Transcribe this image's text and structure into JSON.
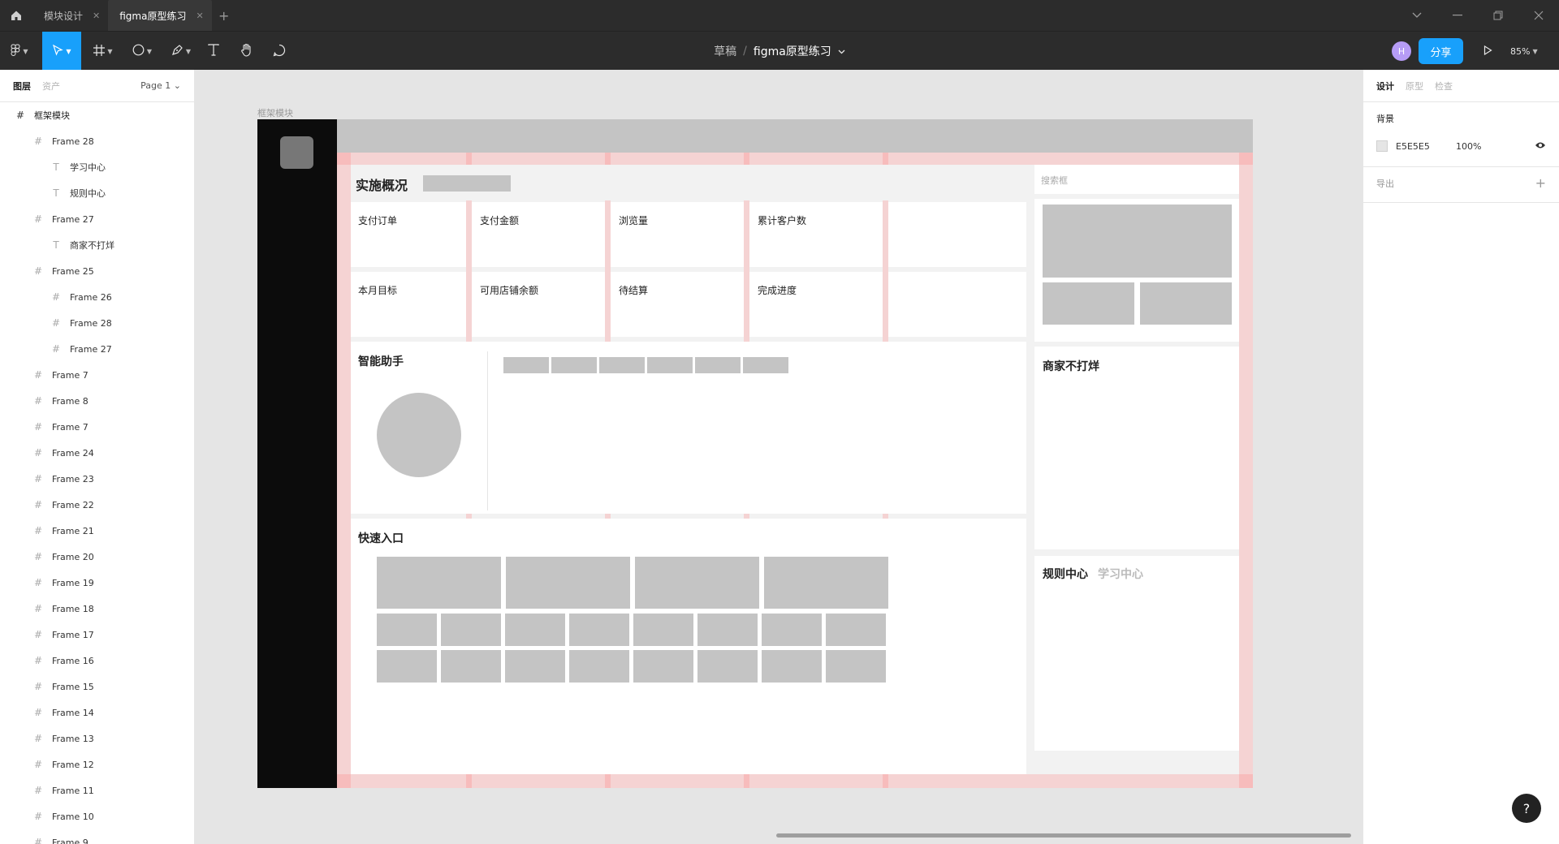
{
  "titlebar": {
    "tabs": [
      {
        "label": "模块设计",
        "active": false
      },
      {
        "label": "figma原型练习",
        "active": true
      }
    ],
    "new_tab": "+"
  },
  "toolbar": {
    "breadcrumb": "草稿",
    "separator": "/",
    "doc_name": "figma原型练习",
    "avatar": "H",
    "share": "分享",
    "zoom": "85%",
    "active_tool": "move"
  },
  "left_panel": {
    "tabs": [
      "图层",
      "资产"
    ],
    "page": "Page 1",
    "layers": [
      {
        "label": "框架模块",
        "icon": "frame",
        "indent": 0
      },
      {
        "label": "Frame 28",
        "icon": "frame",
        "indent": 1
      },
      {
        "label": "学习中心",
        "icon": "text",
        "indent": 2
      },
      {
        "label": "规则中心",
        "icon": "text",
        "indent": 2
      },
      {
        "label": "Frame 27",
        "icon": "frame",
        "indent": 1
      },
      {
        "label": "商家不打烊",
        "icon": "text",
        "indent": 2
      },
      {
        "label": "Frame 25",
        "icon": "frame",
        "indent": 1
      },
      {
        "label": "Frame 26",
        "icon": "frame",
        "indent": 2
      },
      {
        "label": "Frame 28",
        "icon": "frame",
        "indent": 2
      },
      {
        "label": "Frame 27",
        "icon": "frame",
        "indent": 2
      },
      {
        "label": "Frame 7",
        "icon": "frame",
        "indent": 1
      },
      {
        "label": "Frame 8",
        "icon": "frame",
        "indent": 1
      },
      {
        "label": "Frame 7",
        "icon": "frame",
        "indent": 1
      },
      {
        "label": "Frame 24",
        "icon": "frame",
        "indent": 1
      },
      {
        "label": "Frame 23",
        "icon": "frame",
        "indent": 1
      },
      {
        "label": "Frame 22",
        "icon": "frame",
        "indent": 1
      },
      {
        "label": "Frame 21",
        "icon": "frame",
        "indent": 1
      },
      {
        "label": "Frame 20",
        "icon": "frame",
        "indent": 1
      },
      {
        "label": "Frame 19",
        "icon": "frame",
        "indent": 1
      },
      {
        "label": "Frame 18",
        "icon": "frame",
        "indent": 1
      },
      {
        "label": "Frame 17",
        "icon": "frame",
        "indent": 1
      },
      {
        "label": "Frame 16",
        "icon": "frame",
        "indent": 1
      },
      {
        "label": "Frame 15",
        "icon": "frame",
        "indent": 1
      },
      {
        "label": "Frame 14",
        "icon": "frame",
        "indent": 1
      },
      {
        "label": "Frame 13",
        "icon": "frame",
        "indent": 1
      },
      {
        "label": "Frame 12",
        "icon": "frame",
        "indent": 1
      },
      {
        "label": "Frame 11",
        "icon": "frame",
        "indent": 1
      },
      {
        "label": "Frame 10",
        "icon": "frame",
        "indent": 1
      },
      {
        "label": "Frame 9",
        "icon": "frame",
        "indent": 1
      }
    ]
  },
  "right_panel": {
    "tabs": [
      "设计",
      "原型",
      "检查"
    ],
    "background_title": "背景",
    "background_hex": "E5E5E5",
    "background_opacity": "100%",
    "export_title": "导出"
  },
  "canvas": {
    "frame_label": "框架模块",
    "overview_title": "实施概况",
    "search_placeholder": "搜索框",
    "stats_row1": [
      "支付订单",
      "支付金额",
      "浏览量",
      "累计客户数"
    ],
    "stats_row2": [
      "本月目标",
      "可用店铺余额",
      "待结算",
      "完成进度"
    ],
    "assistant_title": "智能助手",
    "quick_entry_title": "快速入口",
    "merchant_title": "商家不打烊",
    "rules_tab": "规则中心",
    "learning_tab": "学习中心"
  },
  "help": "?"
}
